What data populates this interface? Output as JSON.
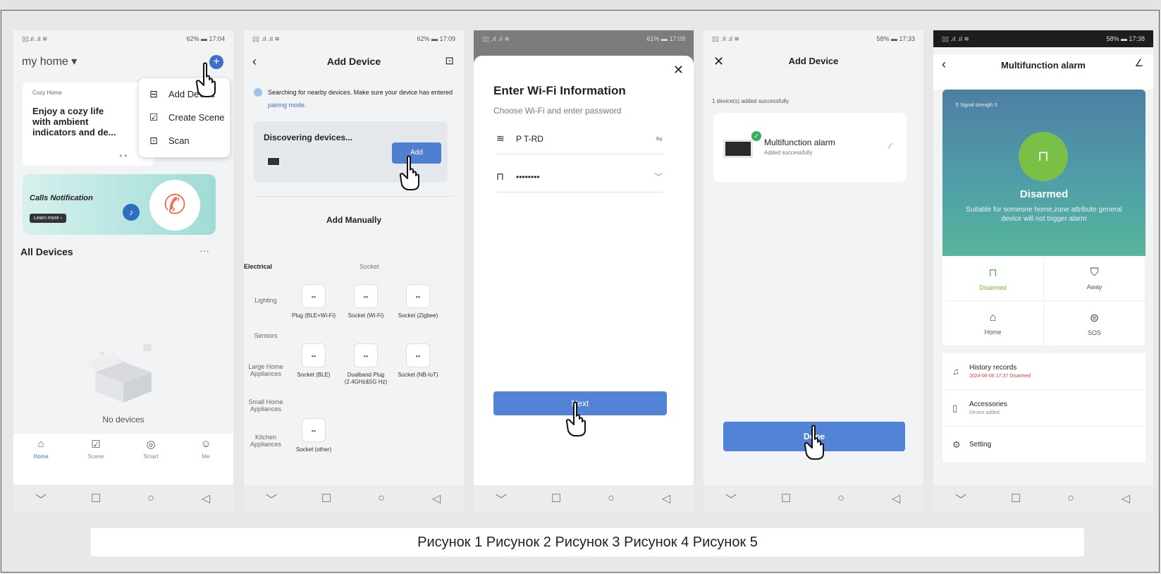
{
  "screens": {
    "s1": {
      "status_left": "▯▯.ıl .ıl ≋",
      "status_right": "62% ▬ 17:04",
      "home_title": "my home ▾",
      "banner_small": "Cozy Home",
      "banner_big": "Enjoy a cozy life with ambient indicators and de...",
      "menu": [
        "Add Device",
        "Create Scene",
        "Scan"
      ],
      "calls_title": "Calls Notification",
      "learn_more": "Learn more ›",
      "all_devices": "All Devices",
      "more": "···",
      "no_devices": "No devices",
      "tabs": [
        "Home",
        "Scene",
        "Smart",
        "Me"
      ]
    },
    "s2": {
      "status_left": "▯▯ .ıl .ıl ≋",
      "status_right": "62% ▬ 17:09",
      "title": "Add Device",
      "search_text": "Searching for nearby devices. Make sure your device has entered",
      "search_link": "pairing mode.",
      "discovering": "Discovering devices...",
      "add_btn": "Add",
      "add_manually": "Add Manually",
      "categories": [
        "Electrical",
        "Lighting",
        "Sensors",
        "Large Home Appliances",
        "Small Home Appliances",
        "Kitchen Appliances"
      ],
      "socket_header": "Socket",
      "devices": [
        "Plug (BLE+Wi-Fi)",
        "Socket (Wi-Fi)",
        "Socket (Zigbee)",
        "Socket (BLE)",
        "Dualband Plug (2.4GHz&5G Hz)",
        "Socket (NB-IoT)",
        "Socket (other)"
      ]
    },
    "s3": {
      "status_left": "▯▯ .ıl .ıl ≋",
      "status_right": "61% ▬ 17:09",
      "heading": "Enter Wi-Fi Information",
      "sub": "Choose Wi-Fi and enter password",
      "wifi_name": "P   T-RD",
      "password": "••••••••",
      "next": "Next"
    },
    "s4": {
      "status_left": "▯▯ .ıl .ıl ≋",
      "status_right": "58% ▬ 17:33",
      "title": "Add Device",
      "count": "1 device(s) added successfully",
      "device_name": "Multifunction alarm",
      "device_status": "Added successfully",
      "done": "Done"
    },
    "s5": {
      "status_left": "▯▯ .ıl .ıl ≋",
      "status_right": "58% ▬ 17:38",
      "title": "Multifunction alarm",
      "signal": "Signal strength 5",
      "state": "Disarmed",
      "state_desc": "Suitable for someone home,zone attribute general device will not trigger alarm",
      "modes": [
        "Disarmed",
        "Away",
        "Home",
        "SOS"
      ],
      "history_title": "History records",
      "history_sub": "2024-06-06 17:37 Disarmed",
      "accessories_title": "Accessories",
      "accessories_sub": "Device added",
      "setting": "Setting"
    }
  },
  "caption": "Рисунок 1 Рисунок 2 Рисунок 3 Рисунок 4 Рисунок 5"
}
